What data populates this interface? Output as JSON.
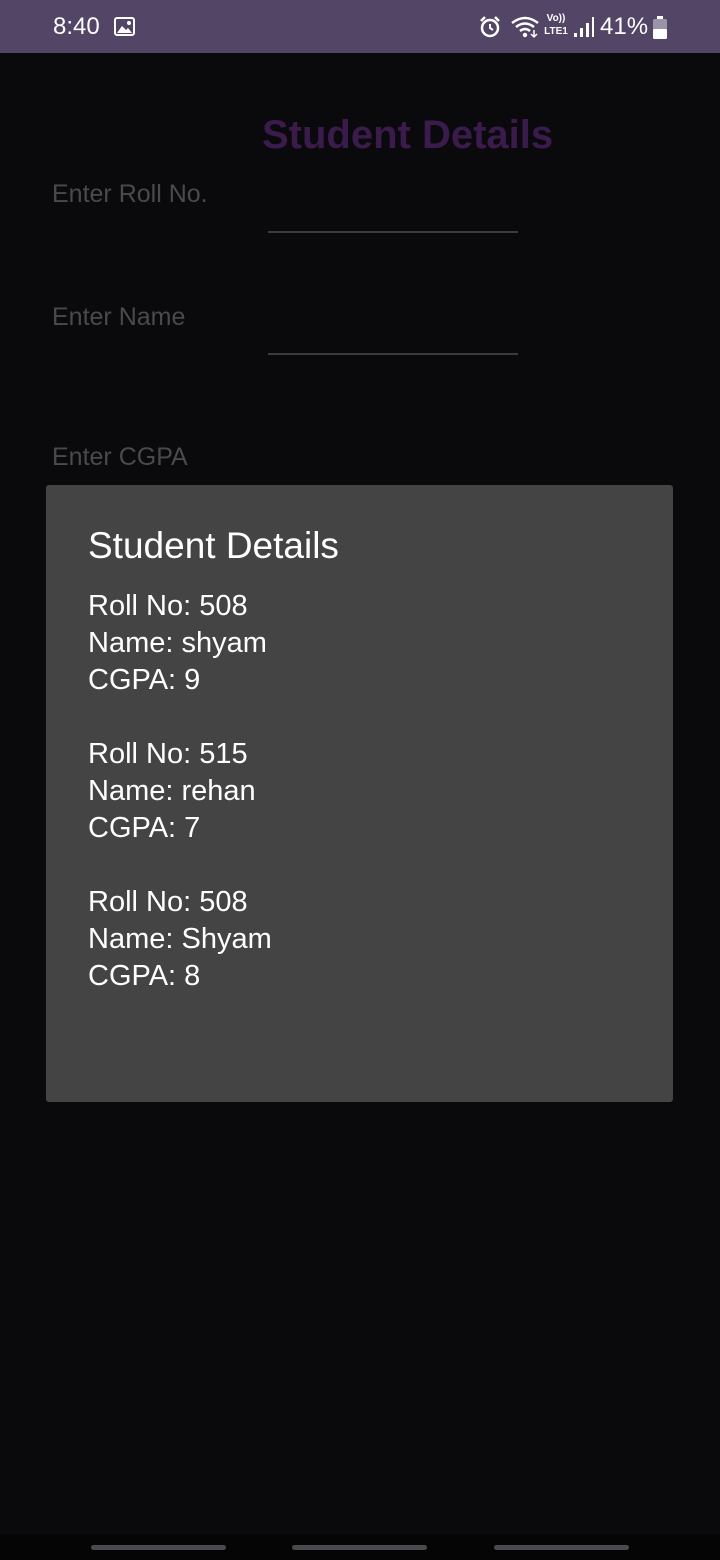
{
  "status_bar": {
    "time": "8:40",
    "volte_line1": "Vo))",
    "volte_line2": "LTE1",
    "battery_percent": "41%",
    "icons": [
      "gallery-icon",
      "alarm-icon",
      "wifi-icon",
      "signal-icon",
      "battery-icon"
    ]
  },
  "form": {
    "title": "Student Details",
    "roll_label": "Enter Roll No.",
    "roll_value": "",
    "name_label": "Enter Name",
    "name_value": "",
    "cgpa_label": "Enter CGPA"
  },
  "dialog": {
    "title": "Student Details",
    "message": "Roll No: 508\nName: shyam\nCGPA: 9\n\nRoll No: 515\nName: rehan\nCGPA: 7\n\nRoll No: 508\nName: Shyam\nCGPA: 8"
  },
  "colors": {
    "status_bar": "#524566",
    "background": "#0a0a0c",
    "dialog": "#444444",
    "title_accent": "#3b1a4c"
  }
}
